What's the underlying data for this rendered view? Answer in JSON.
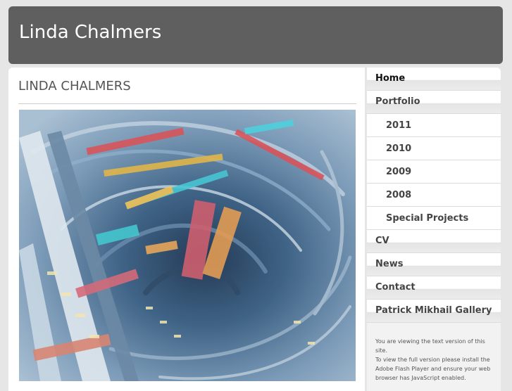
{
  "header": {
    "site_title": "Linda Chalmers"
  },
  "main": {
    "page_title": "LINDA CHALMERS",
    "artwork_alt": "Painting"
  },
  "sidebar": {
    "items": [
      {
        "label": "Home"
      },
      {
        "label": "Portfolio"
      },
      {
        "label": "2011"
      },
      {
        "label": "2010"
      },
      {
        "label": "2009"
      },
      {
        "label": "2008"
      },
      {
        "label": "Special Projects"
      },
      {
        "label": "CV"
      },
      {
        "label": "News"
      },
      {
        "label": "Contact"
      },
      {
        "label": "Patrick Mikhail Gallery"
      }
    ],
    "note_line1": "You are viewing the text version of this site.",
    "note_line2": "To view the full version please install the Adobe Flash Player and ensure your web browser has JavaScript enabled."
  },
  "colors": {
    "header_bg": "#5f5f5f",
    "page_bg": "#e6e6e6",
    "content_bg": "#ffffff"
  }
}
